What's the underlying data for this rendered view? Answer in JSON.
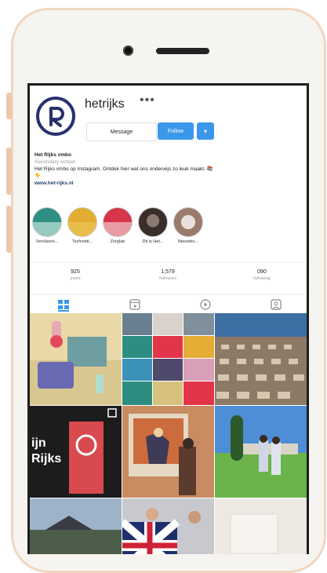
{
  "profile": {
    "username": "hetrijks",
    "more_icon": "more-dots-icon",
    "message_label": "Message",
    "follow_label": "Follow",
    "name": "Het Rijks vmbo",
    "category": "Secondary school",
    "bio_line": "Het Rijks vmbo op Instagram. Ontdek hier wat ons onderwijs zo leuk maakt. 📚",
    "bio_line2": "👇",
    "website": "www.het-rijks.nl"
  },
  "highlights": [
    {
      "label": "Verslaveri...",
      "color_top": "#2f8f83",
      "color_bottom": "#96c9c0"
    },
    {
      "label": "Technieti...",
      "color_top": "#e3ad32",
      "color_bottom": "#e9bd4a"
    },
    {
      "label": "Zorglab",
      "color_top": "#d7354a",
      "color_bottom": "#e99aa3"
    },
    {
      "label": "Dit is Het...",
      "color_top": "#5b4a43",
      "color_bottom": "#2a2220"
    },
    {
      "label": "Nieuwbo...",
      "color_top": "#9a7a6a",
      "color_bottom": "#d8cfc8"
    }
  ],
  "stats": {
    "posts_value": "925",
    "posts_label": "posts",
    "followers_value": "1,579",
    "followers_label": "followers",
    "following_value": "090",
    "following_label": "following"
  },
  "tabs": [
    "grid-icon",
    "reels-icon",
    "video-icon",
    "tagged-icon"
  ],
  "colors": {
    "accent": "#3b97ea",
    "logo": "#2a2f6e"
  }
}
